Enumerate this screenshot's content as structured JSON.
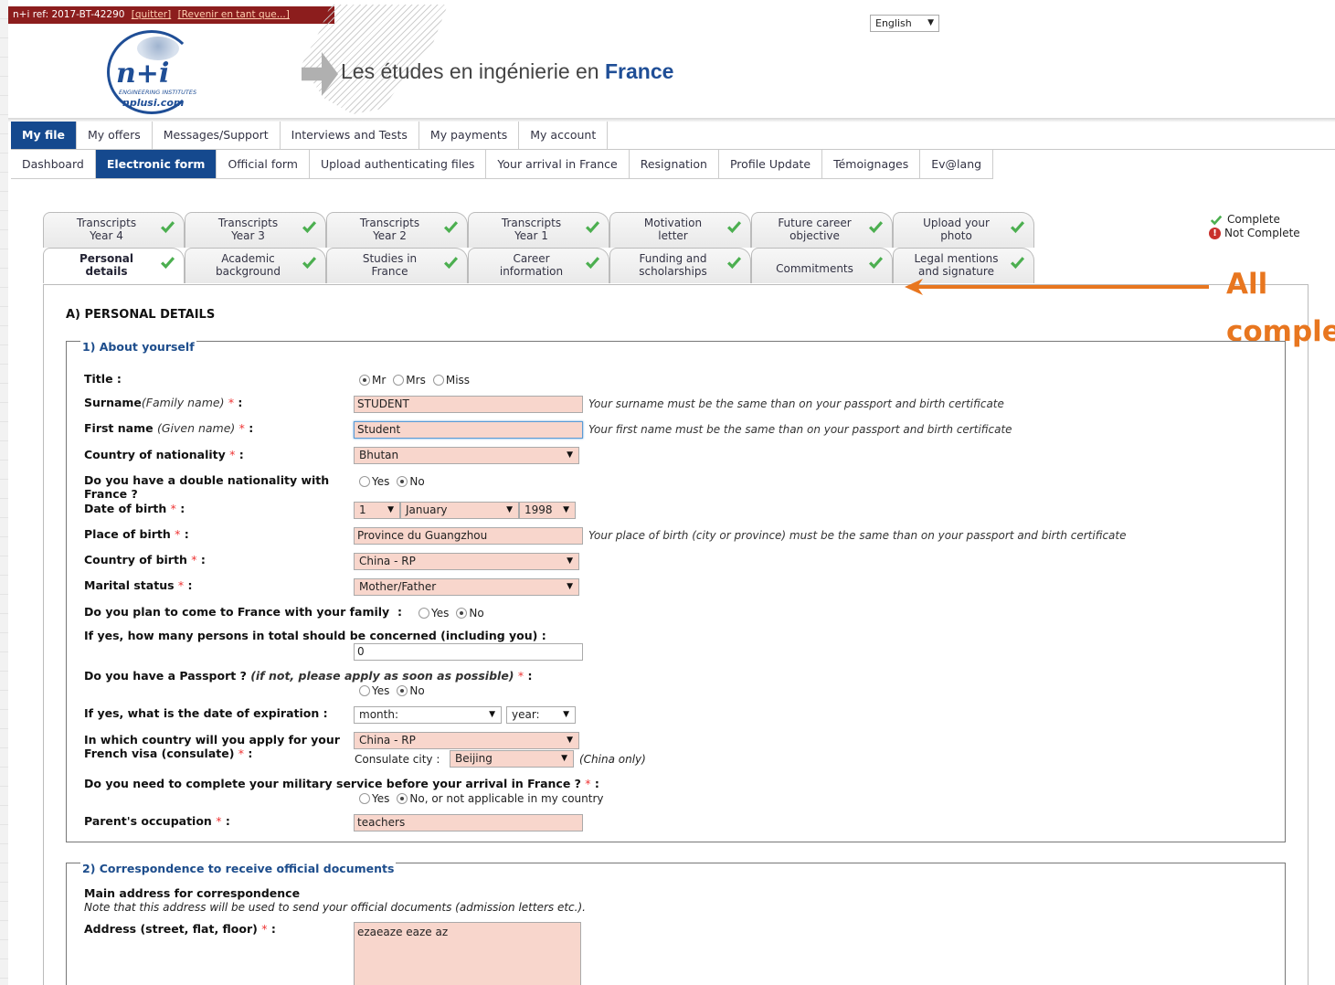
{
  "ref_bar": {
    "text": "n+i ref: 2017-BT-42290",
    "quit": "[quitter]",
    "revert": "[Revenir en tant que...]"
  },
  "logo": {
    "text": "n+i",
    "subtitle": "ENGINEERING INSTITUTES",
    "url": "nplusi.com"
  },
  "site_title": {
    "prefix": "Les études en ingénierie en",
    "bold": "France"
  },
  "language": {
    "selected": "English"
  },
  "main_nav": [
    "My file",
    "My offers",
    "Messages/Support",
    "Interviews and Tests",
    "My payments",
    "My account"
  ],
  "sub_nav": [
    "Dashboard",
    "Electronic form",
    "Official form",
    "Upload authenticating files",
    "Your arrival in France",
    "Resignation",
    "Profile Update",
    "Témoignages",
    "Ev@lang"
  ],
  "tabs_top": [
    {
      "l1": "Transcripts",
      "l2": "Year 4"
    },
    {
      "l1": "Transcripts",
      "l2": "Year 3"
    },
    {
      "l1": "Transcripts",
      "l2": "Year 2"
    },
    {
      "l1": "Transcripts",
      "l2": "Year 1"
    },
    {
      "l1": "Motivation",
      "l2": "letter"
    },
    {
      "l1": "Future career",
      "l2": "objective"
    },
    {
      "l1": "Upload your",
      "l2": "photo"
    }
  ],
  "tabs_bottom": [
    {
      "l1": "Personal",
      "l2": "details"
    },
    {
      "l1": "Academic",
      "l2": "background"
    },
    {
      "l1": "Studies in",
      "l2": "France"
    },
    {
      "l1": "Career",
      "l2": "information"
    },
    {
      "l1": "Funding and",
      "l2": "scholarships"
    },
    {
      "l1": "Commitments",
      "l2": ""
    },
    {
      "l1": "Legal mentions",
      "l2": "and signature"
    }
  ],
  "legend": {
    "complete": "Complete",
    "not_complete": "Not Complete"
  },
  "annotation": {
    "line1": "All",
    "line2": "comple"
  },
  "section_title": "A) PERSONAL DETAILS",
  "fieldset1": "1) About yourself",
  "fieldset2": "2) Correspondence to receive official documents",
  "form": {
    "title_label": "Title :",
    "title_options": [
      "Mr",
      "Mrs",
      "Miss"
    ],
    "surname_label": "Surname",
    "surname_hint_label": "(Family name)",
    "surname_value": "STUDENT",
    "surname_hint": "Your surname must be the same than on your passport and birth certificate",
    "firstname_label": "First name",
    "firstname_hint_label": "(Given name)",
    "firstname_value": "Student",
    "firstname_hint": "Your first name must be the same than on your passport and birth certificate",
    "nationality_label": "Country of nationality",
    "nationality_value": "Bhutan",
    "double_nat_label_1": "Do you have a double nationality with",
    "double_nat_label_2": "France ?",
    "yes": "Yes",
    "no": "No",
    "dob_label": "Date of birth",
    "dob_day": "1",
    "dob_month": "January",
    "dob_year": "1998",
    "pob_label": "Place of birth",
    "pob_value": "Province du Guangzhou",
    "pob_hint": "Your place of birth (city or province) must be the same than on your passport and birth certificate",
    "cob_label": "Country of birth",
    "cob_value": "China - RP",
    "marital_label": "Marital status",
    "marital_value": "Mother/Father",
    "family_label": "Do you plan to come to France with your family",
    "persons_label": "If yes, how many persons in total should be concerned (including you) :",
    "persons_value": "0",
    "passport_label": "Do you have a Passport ?",
    "passport_note": "(if not, please apply as soon as possible)",
    "expiration_label": "If yes, what is the date of expiration :",
    "exp_month": "month:",
    "exp_year": "year:",
    "visa_label_1": "In which country will you apply for your",
    "visa_label_2": "French visa (consulate)",
    "visa_value": "China - RP",
    "consulate_city_label": "Consulate city :",
    "consulate_city_value": "Beijing",
    "china_only": "(China only)",
    "military_label": "Do you need to complete your military service before your arrival in France ?",
    "military_no": "No, or not applicable in my country",
    "parent_label": "Parent's occupation",
    "parent_value": "teachers",
    "main_address_label": "Main address for correspondence",
    "main_address_note": "Note that this address will be used to send your official documents (admission letters etc.).",
    "address_label": "Address (street, flat, floor)",
    "address_value": "ezaeaze eaze az",
    "required_mark": "*",
    "colon": ":"
  },
  "colors": {
    "nav_active": "#15498e",
    "required_field": "#f8d6cc",
    "annotation": "#e8761f",
    "check": "#4caf50"
  }
}
